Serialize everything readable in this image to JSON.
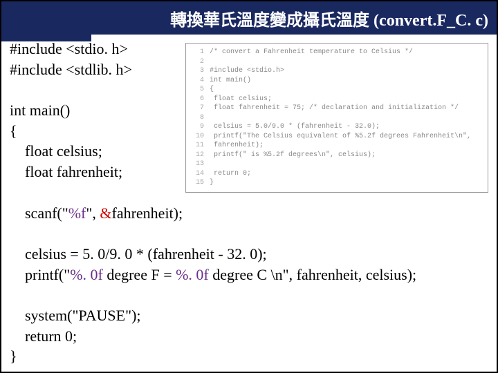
{
  "title": "轉換華氏溫度變成攝氏溫度 (convert.F_C. c)",
  "main": {
    "l1": "#include <stdio. h>",
    "l2": "#include <stdlib. h>",
    "l3": "int main()",
    "l4": "{",
    "l5": "    float celsius;",
    "l6": "    float fahrenheit;",
    "l7a": "    scanf(\"",
    "l7fmt": "%f",
    "l7b": "\", ",
    "l7amp": "&",
    "l7c": "fahrenheit);",
    "l8": "    celsius = 5. 0/9. 0 * (fahrenheit - 32. 0);",
    "l9a": "    printf(\"",
    "l9f1": "%. 0f ",
    "l9b": "degree F = ",
    "l9f2": "%. 0f ",
    "l9c": "degree C \\n\", fahrenheit, celsius);",
    "l10": "    system(\"PAUSE\");",
    "l11": "    return 0;",
    "l12": "}"
  },
  "snippet": [
    "/* convert a Fahrenheit temperature to Celsius */",
    "",
    "#include <stdio.h>",
    "int main()",
    "{",
    "    float celsius;",
    "    float fahrenheit = 75;  /* declaration and initialization */",
    "",
    "    celsius = 5.0/9.0 * (fahrenheit - 32.0);",
    "    printf(\"The Celsius equivalent of %5.2f degrees Fahrenheit\\n\",",
    "                                                    fahrenheit);",
    "    printf(\"    is %5.2f degrees\\n\", celsius);",
    "",
    "    return 0;",
    "}"
  ]
}
